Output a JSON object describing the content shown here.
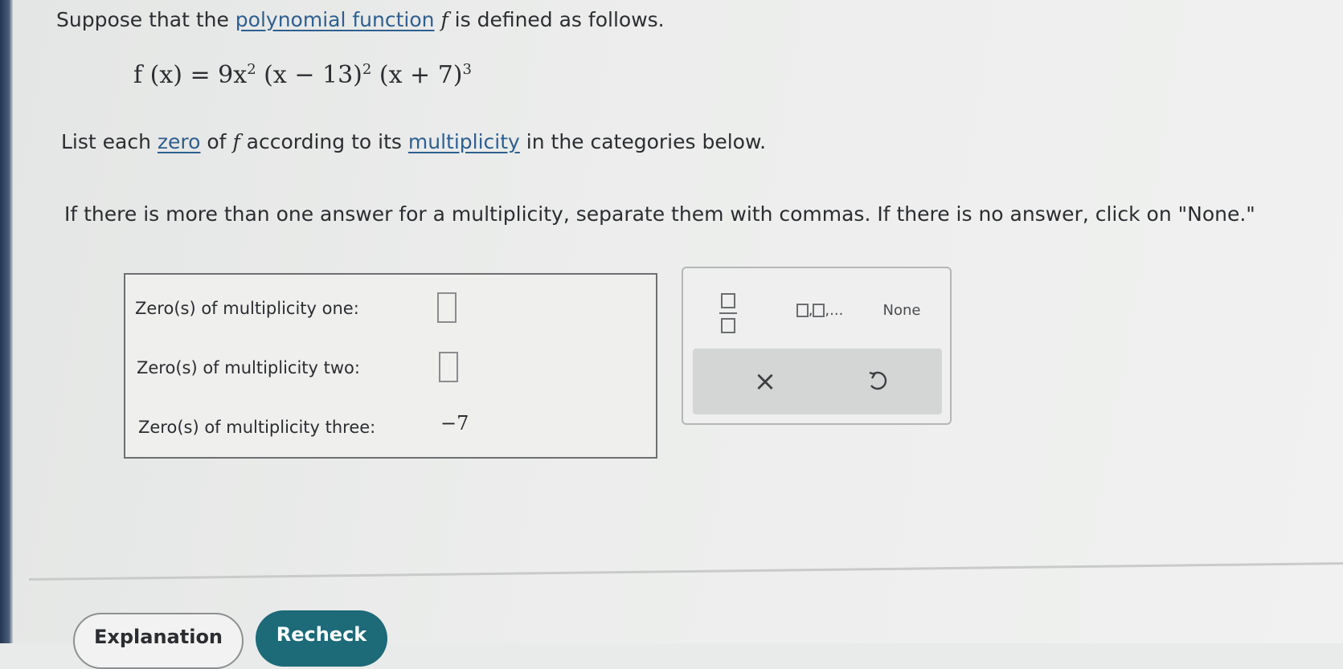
{
  "question": {
    "intro_text_before": "Suppose that the",
    "intro_link": "polynomial function",
    "intro_var": "f",
    "intro_text_after": "is defined as follows.",
    "formula": {
      "lhs": "f (x) = 9x",
      "exp1": "2",
      "factor2": " (x − 13)",
      "exp2": "2",
      "factor3": " (x + 7)",
      "exp3": "3"
    },
    "instr_before": "List each",
    "instr_link1": "zero",
    "instr_mid1": "of",
    "instr_var": "f",
    "instr_mid2": "according to its",
    "instr_link2": "multiplicity",
    "instr_after": "in the categories below.",
    "note": "If there is more than one answer for a multiplicity, separate them with commas. If there is no answer, click on \"None.\""
  },
  "answers": {
    "row1_label": "Zero(s) of multiplicity one:",
    "row2_label": "Zero(s) of multiplicity two:",
    "row3_label": "Zero(s) of multiplicity three:",
    "row3_value": "−7"
  },
  "keypad": {
    "list_label": ",",
    "list_ellipsis": ",...",
    "none_label": "None",
    "clear_symbol": "×"
  },
  "footer": {
    "explanation_label": "Explanation",
    "recheck_label": "Recheck"
  },
  "colors": {
    "link": "#2f5f8f",
    "recheck_bg": "#1d6a78"
  }
}
